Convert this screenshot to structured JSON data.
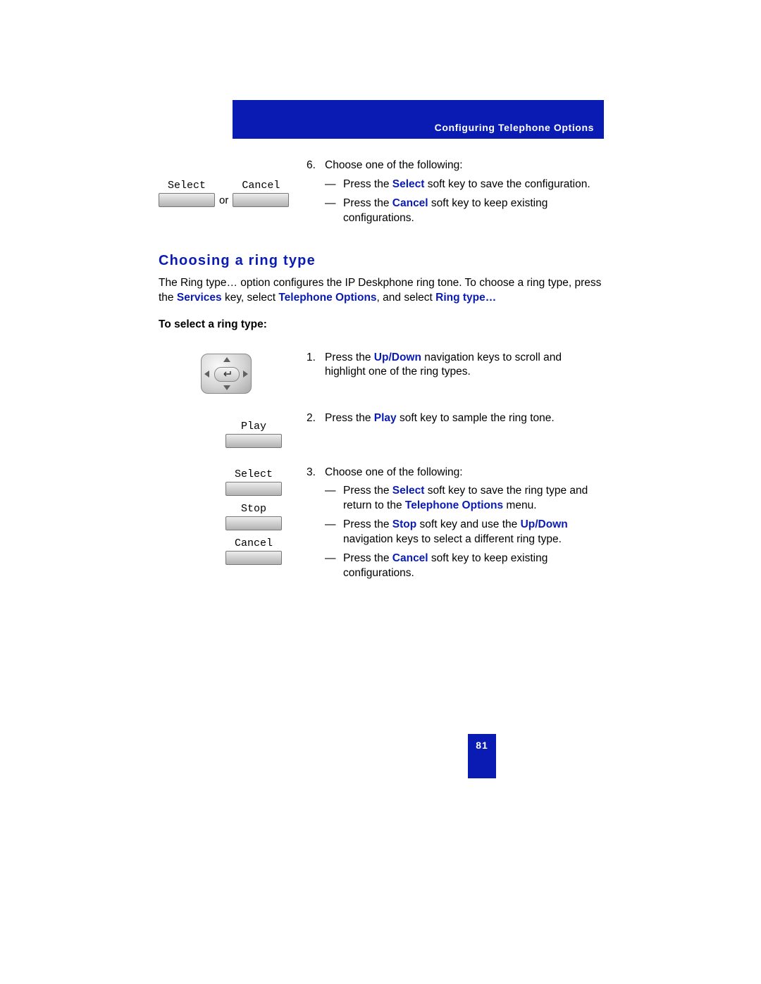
{
  "header": {
    "title": "Configuring Telephone Options"
  },
  "step6": {
    "num": "6.",
    "intro": "Choose one of the following:",
    "dash": "—",
    "a_pre": "Press the ",
    "a_key": "Select",
    "a_post": " soft key to save the configuration.",
    "b_pre": "Press the ",
    "b_key": "Cancel",
    "b_post": " soft key to keep existing configurations.",
    "softkey_select": "Select",
    "softkey_cancel": "Cancel",
    "or": "or"
  },
  "section": {
    "title": "Choosing a ring type",
    "para_a": "The Ring type… option configures the IP Deskphone ring tone. To choose a ring type, press the ",
    "para_services": "Services",
    "para_b": " key, select ",
    "para_telopt": "Telephone Options",
    "para_c": ", and select ",
    "para_ringtype": "Ring type…",
    "subhead": "To select a ring type:"
  },
  "step1": {
    "num": "1.",
    "pre": "Press the ",
    "key": "Up/Down",
    "post": " navigation keys to scroll and highlight one of the ring types."
  },
  "step2": {
    "num": "2.",
    "pre": "Press the ",
    "key": "Play",
    "post": " soft key to sample the ring tone.",
    "softkey_play": "Play"
  },
  "step3": {
    "num": "3.",
    "intro": "Choose one of the following:",
    "dash": "—",
    "a_pre": "Press the ",
    "a_key": "Select",
    "a_mid": " soft key to save the ring type and return to the ",
    "a_telopt": "Telephone Options",
    "a_post": " menu.",
    "b_pre": "Press the ",
    "b_key": "Stop",
    "b_mid": " soft key and use the ",
    "b_updown": "Up/Down",
    "b_post": " navigation keys to select a different ring type.",
    "c_pre": "Press the ",
    "c_key": "Cancel",
    "c_post": " soft key to keep existing configurations.",
    "softkey_select": "Select",
    "softkey_stop": "Stop",
    "softkey_cancel": "Cancel"
  },
  "page_number": "81"
}
